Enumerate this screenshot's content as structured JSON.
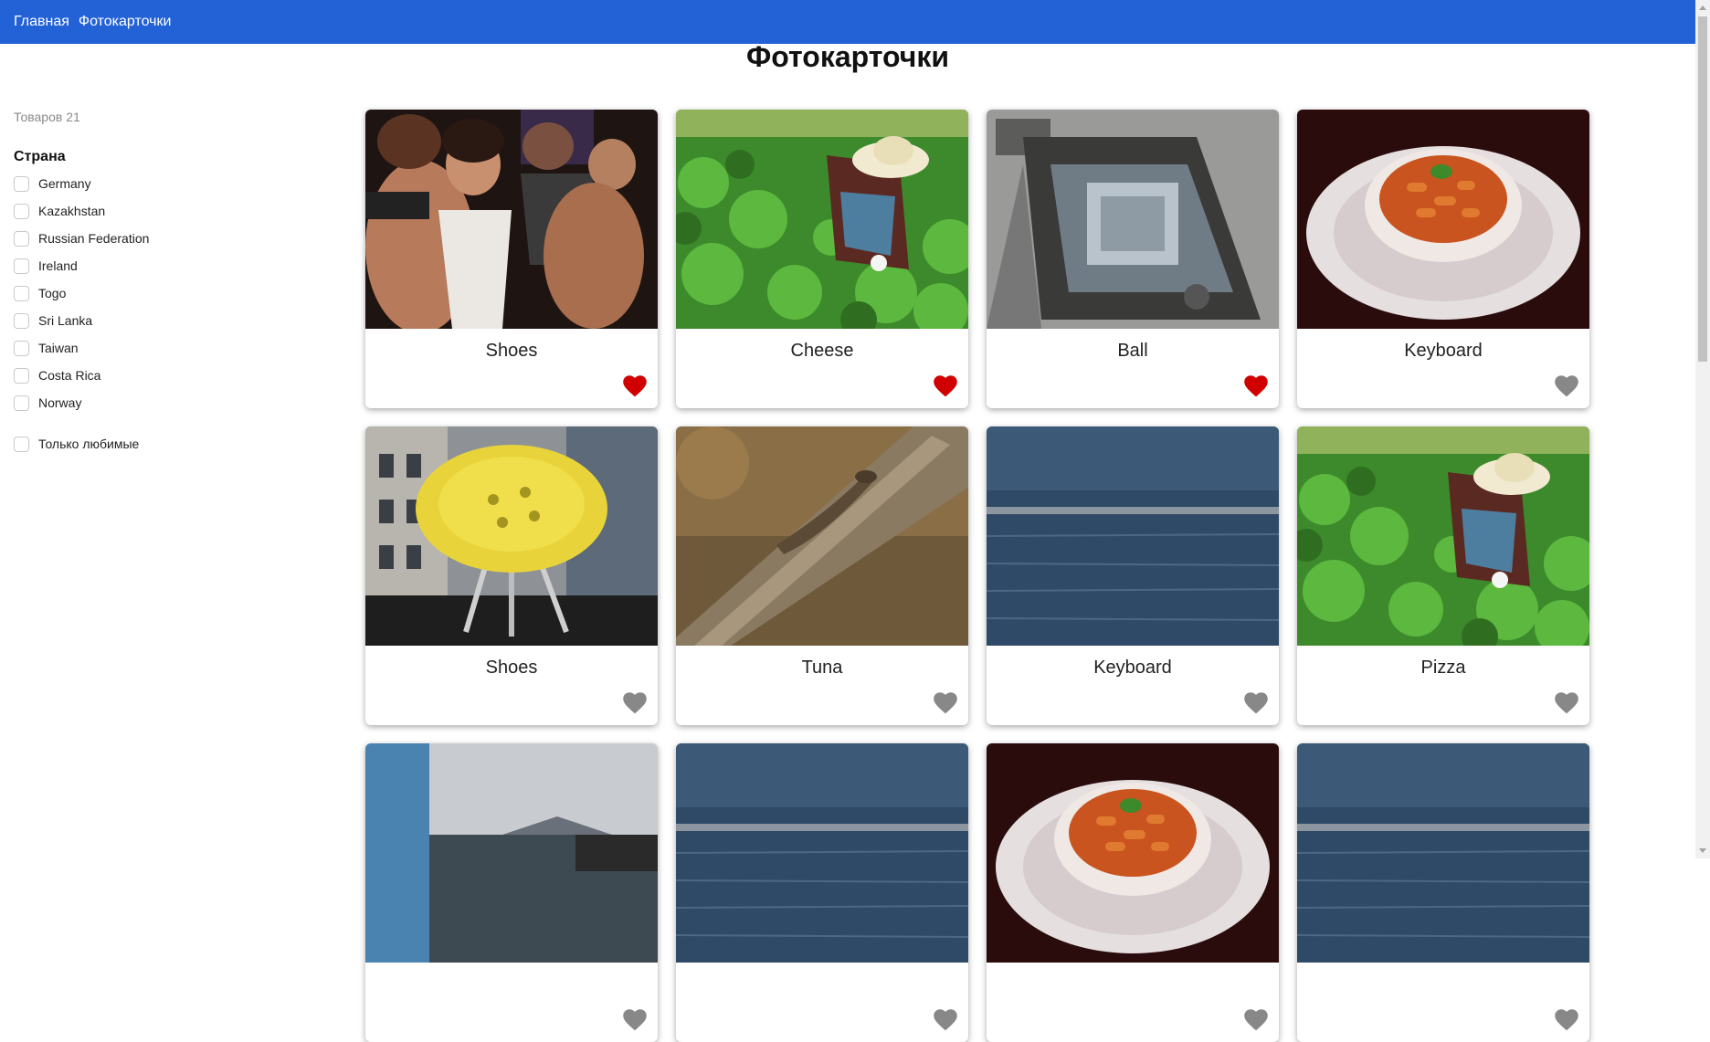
{
  "nav": {
    "home": "Главная",
    "photos": "Фотокарточки"
  },
  "page": {
    "title": "Фотокарточки"
  },
  "sidebar": {
    "count": "Товаров 21",
    "filter_title": "Страна",
    "countries": [
      "Germany",
      "Kazakhstan",
      "Russian Federation",
      "Ireland",
      "Togo",
      "Sri Lanka",
      "Taiwan",
      "Costa Rica",
      "Norway"
    ],
    "favorites_only": "Только любимые"
  },
  "cards": [
    {
      "title": "Shoes",
      "favorite": true,
      "image": "party-dancers"
    },
    {
      "title": "Cheese",
      "favorite": true,
      "image": "farmer-field"
    },
    {
      "title": "Ball",
      "favorite": true,
      "image": "floor-box"
    },
    {
      "title": "Keyboard",
      "favorite": false,
      "image": "pasta-bowl"
    },
    {
      "title": "Shoes",
      "favorite": false,
      "image": "yellow-stool"
    },
    {
      "title": "Tuna",
      "favorite": false,
      "image": "lizard-wood"
    },
    {
      "title": "Keyboard",
      "favorite": false,
      "image": "sea-water"
    },
    {
      "title": "Pizza",
      "favorite": false,
      "image": "farmer-field"
    },
    {
      "title": "",
      "favorite": false,
      "image": "harbor-volcano"
    },
    {
      "title": "",
      "favorite": false,
      "image": "sea-water"
    },
    {
      "title": "",
      "favorite": false,
      "image": "pasta-bowl"
    },
    {
      "title": "",
      "favorite": false,
      "image": "sea-water"
    }
  ],
  "colors": {
    "nav_bg": "#2261d6",
    "heart_active": "#d10000",
    "heart_inactive": "#888888"
  }
}
